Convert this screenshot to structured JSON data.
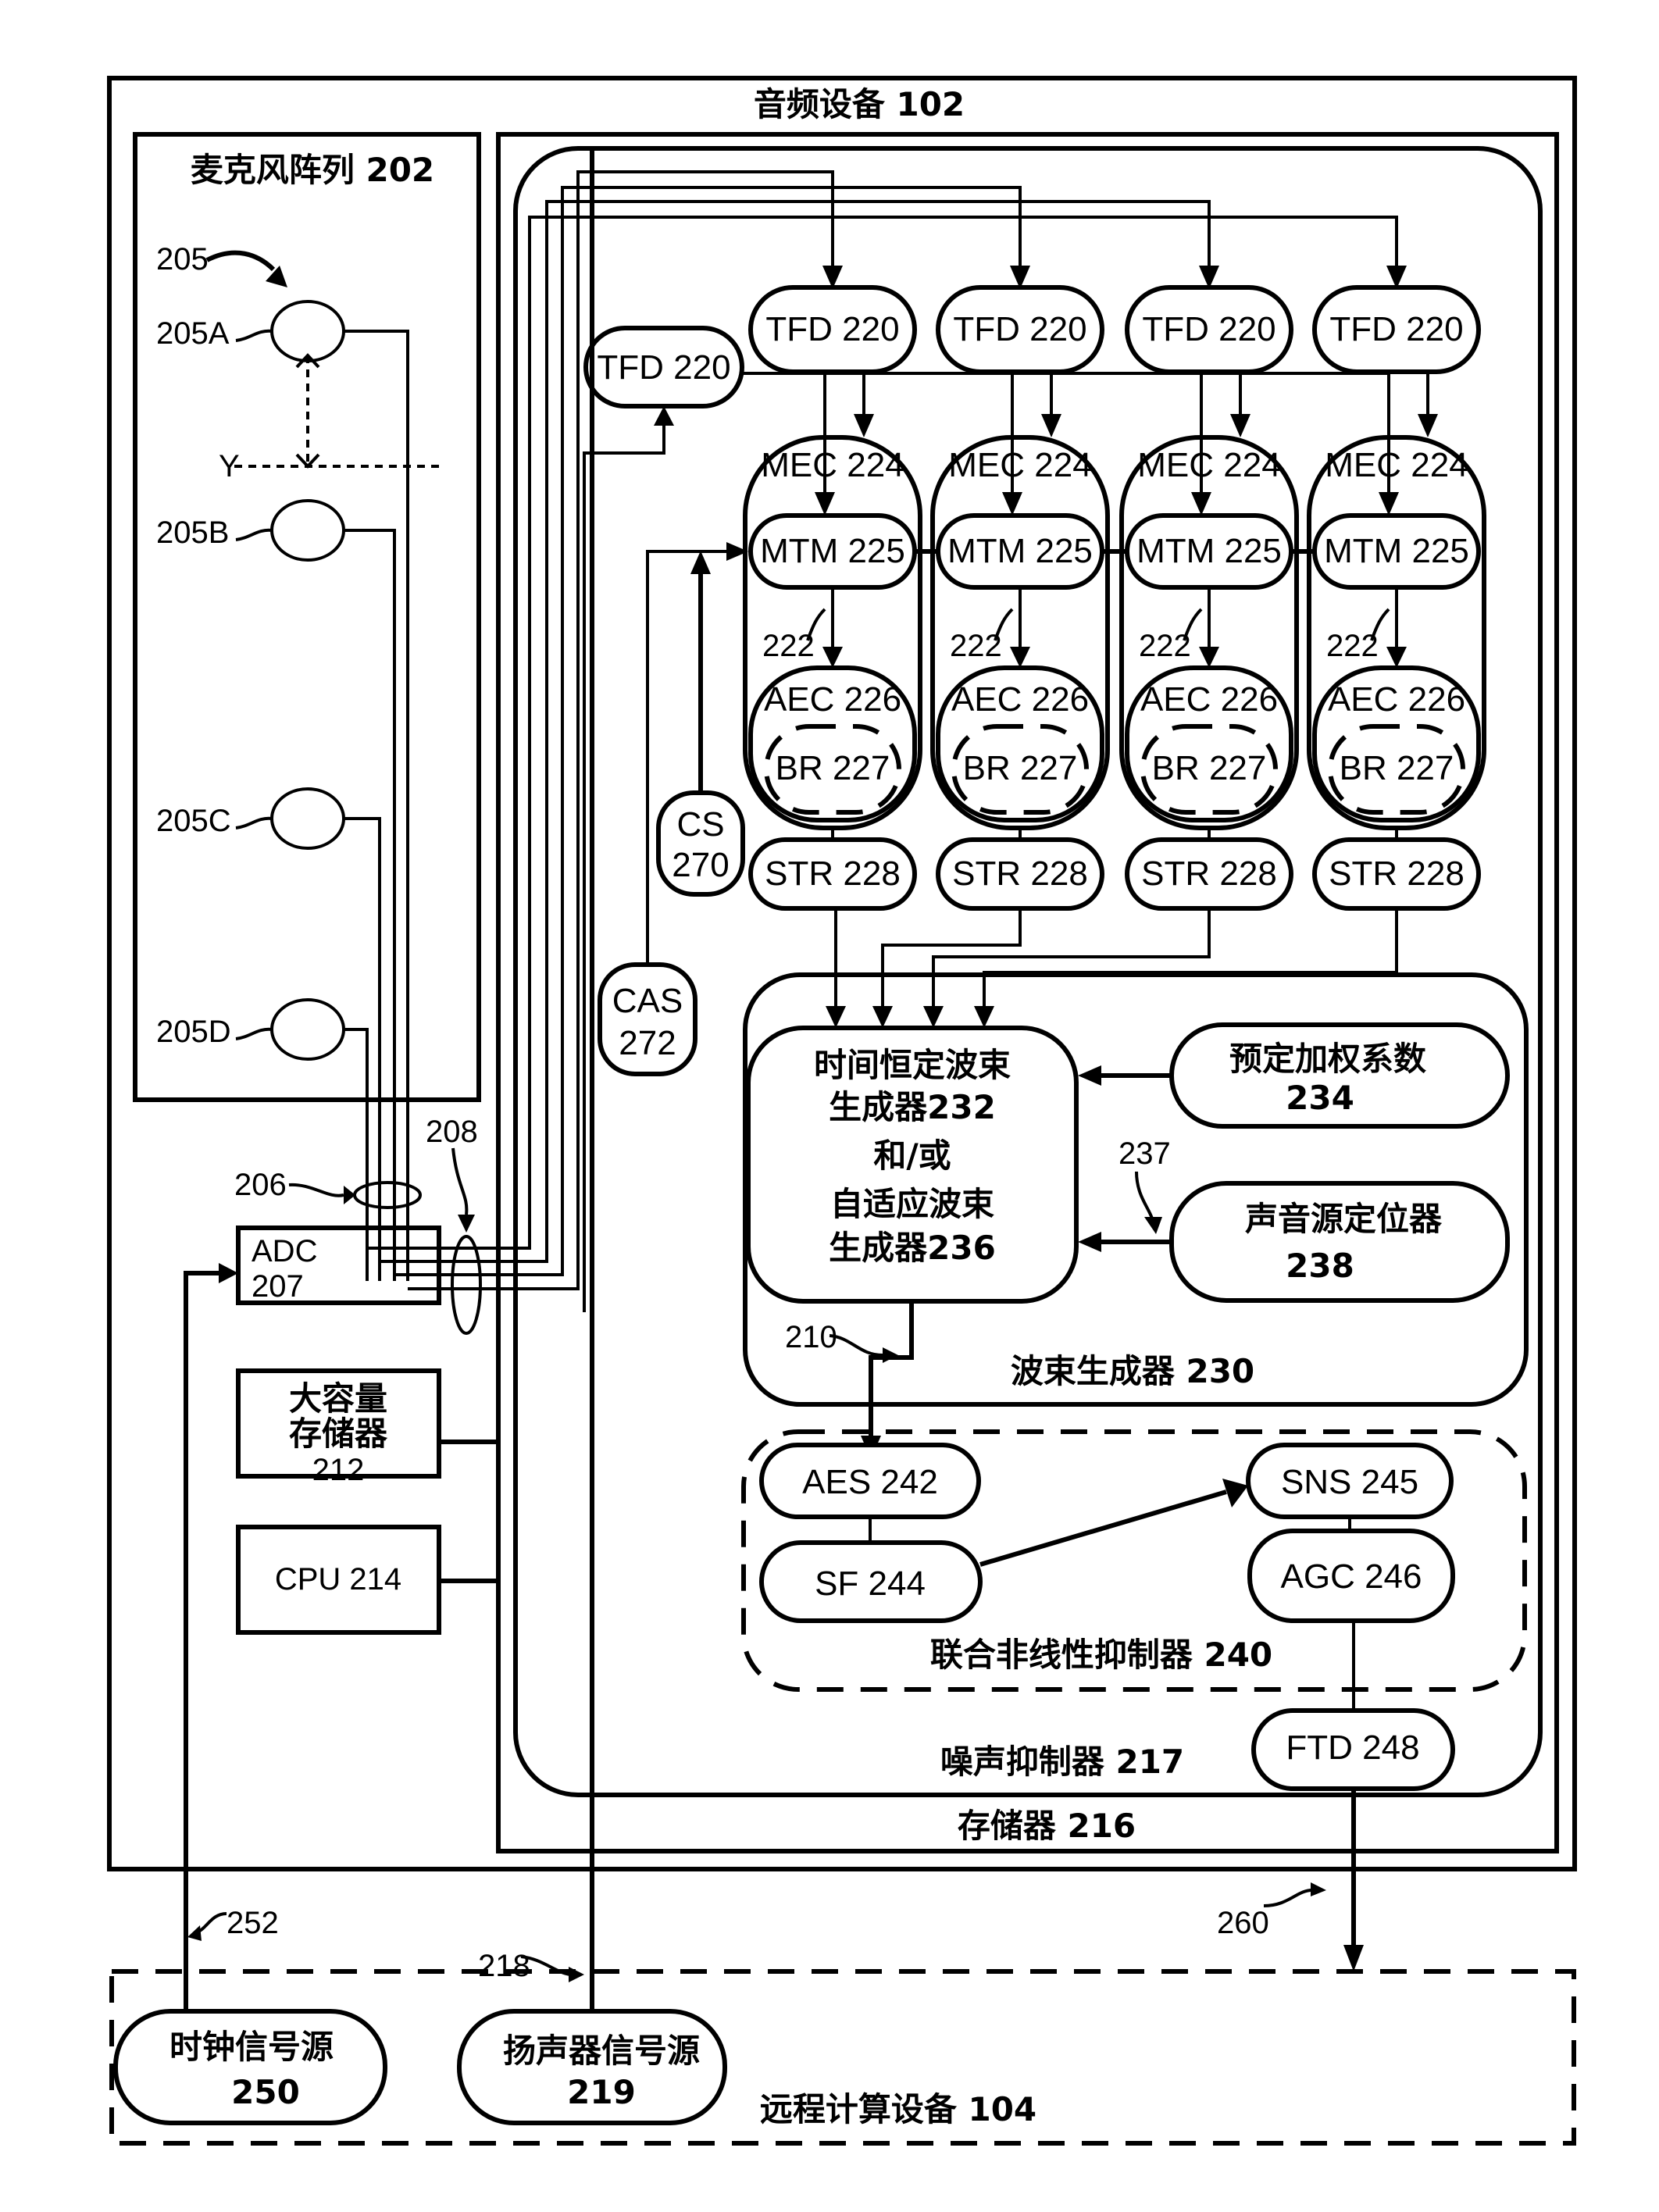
{
  "figure": {
    "audio_device": "音频设备 102",
    "mic_array": {
      "title": "麦克风阵列 202",
      "group_ref": "205",
      "mics": [
        "205A",
        "205B",
        "205C",
        "205D"
      ],
      "spacing_label": "Y"
    },
    "refs": {
      "bus_206": "206",
      "bus_208": "208",
      "ref_222": "222",
      "ref_237": "237",
      "ref_210": "210",
      "ref_252": "252",
      "ref_218": "218",
      "ref_260": "260"
    },
    "adc": {
      "line1": "ADC",
      "line2": "207"
    },
    "mass_storage": {
      "line1": "大容量",
      "line2": "存储器",
      "line3": "212"
    },
    "cpu": "CPU 214",
    "memory": "存储器 216",
    "noise_suppressor": "噪声抑制器 217",
    "tfd_left": "TFD 220",
    "channels": [
      {
        "tfd": "TFD 220",
        "mec": "MEC 224",
        "mtm": "MTM 225",
        "aec": "AEC 226",
        "br": "BR 227",
        "str": "STR 228"
      },
      {
        "tfd": "TFD 220",
        "mec": "MEC 224",
        "mtm": "MTM 225",
        "aec": "AEC 226",
        "br": "BR 227",
        "str": "STR 228"
      },
      {
        "tfd": "TFD 220",
        "mec": "MEC 224",
        "mtm": "MTM 225",
        "aec": "AEC 226",
        "br": "BR 227",
        "str": "STR 228"
      },
      {
        "tfd": "TFD 220",
        "mec": "MEC 224",
        "mtm": "MTM 225",
        "aec": "AEC 226",
        "br": "BR 227",
        "str": "STR 228"
      }
    ],
    "cs": {
      "line1": "CS",
      "line2": "270"
    },
    "cas": {
      "line1": "CAS",
      "line2": "272"
    },
    "beamformer": {
      "title": "波束生成器  230",
      "main_lines": [
        "时间恒定波束",
        "生成器232",
        "和/或",
        "自适应波束",
        "生成器236"
      ],
      "weights": {
        "line1": "预定加权系数",
        "line2": "234"
      },
      "locator": {
        "line1": "声音源定位器",
        "line2": "238"
      }
    },
    "nonlinear": {
      "title": "联合非线性抑制器  240",
      "aes": "AES 242",
      "sf": "SF 244",
      "sns": "SNS 245",
      "agc": "AGC 246"
    },
    "ftd": "FTD 248",
    "remote": {
      "title": "远程计算设备  104",
      "clock": {
        "line1": "时钟信号源",
        "line2": "250"
      },
      "speaker": {
        "line1": "扬声器信号源",
        "line2": "219"
      }
    }
  }
}
